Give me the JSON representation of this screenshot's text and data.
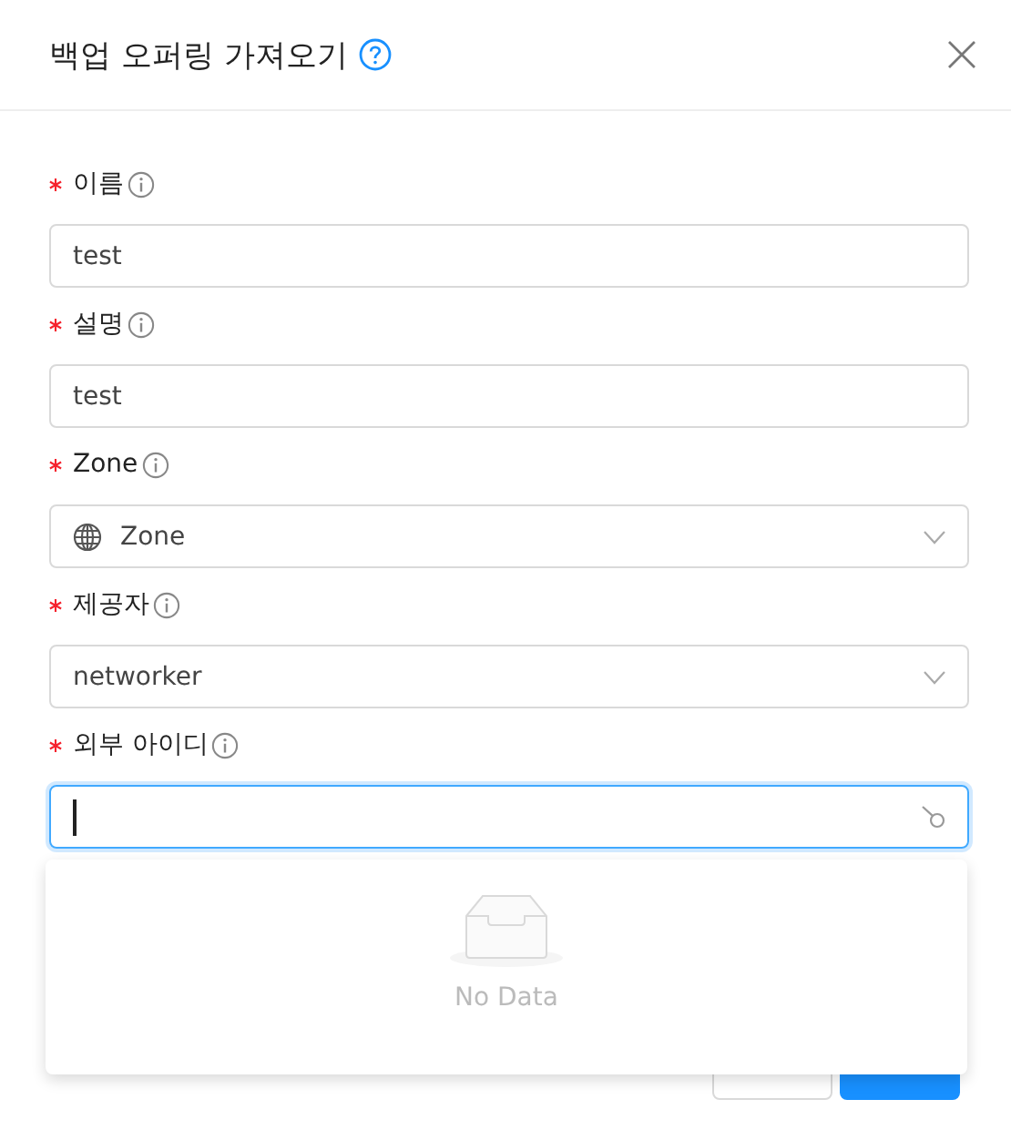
{
  "dialog": {
    "title": "백업 오퍼링 가져오기"
  },
  "fields": [
    {
      "label": "이름",
      "required": true,
      "kind": "text",
      "value": "test",
      "focused": false
    },
    {
      "label": "설명",
      "required": true,
      "kind": "text",
      "value": "test",
      "focused": false
    },
    {
      "label": "Zone",
      "required": true,
      "kind": "zone",
      "value": "Zone",
      "focused": false
    },
    {
      "label": "제공자",
      "required": true,
      "kind": "select",
      "value": "networker",
      "focused": false
    },
    {
      "label": "외부 아이디",
      "required": true,
      "kind": "search",
      "focused": true
    }
  ],
  "dropdown": {
    "empty_text": "No Data"
  },
  "buttons": [
    {
      "kind": "default"
    },
    {
      "kind": "primary"
    }
  ]
}
